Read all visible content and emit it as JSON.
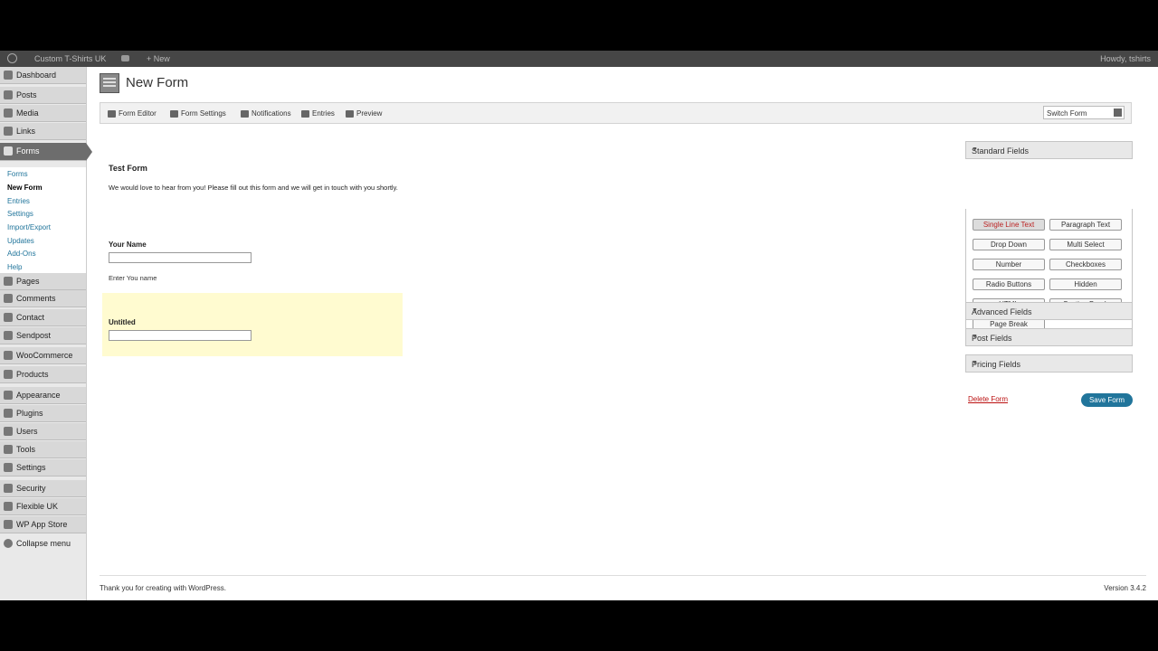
{
  "adminbar": {
    "site": "Custom T-Shirts UK",
    "new": "New",
    "howdy": "Howdy, tshirts"
  },
  "sidebar": {
    "top_items": [
      "Dashboard",
      "Posts",
      "Media",
      "Links"
    ],
    "forms_label": "Forms",
    "submenu": [
      "Forms",
      "New Form",
      "Entries",
      "Settings",
      "Import/Export",
      "Updates",
      "Add-Ons",
      "Help"
    ],
    "bottom_items": [
      "Pages",
      "Comments",
      "Contact",
      "Sendpost",
      "WooCommerce",
      "Products",
      "Appearance",
      "Plugins",
      "Users",
      "Tools",
      "Settings",
      "Security",
      "Flexible UK",
      "WP App Store",
      "Collapse menu"
    ]
  },
  "header": {
    "title": "New Form"
  },
  "toolbar": {
    "items": [
      "Form Editor",
      "Form Settings",
      "Notifications",
      "Entries",
      "Preview"
    ],
    "switch_form": "Switch Form"
  },
  "form": {
    "title": "Test Form",
    "description": "We would love to hear from you! Please fill out this form and we will get in touch with you shortly.",
    "field1_label": "Your Name",
    "field1_desc": "Enter You name",
    "field2_label": "Untitled"
  },
  "panel": {
    "standard_title": "Standard Fields",
    "standard_buttons": [
      "Single Line Text",
      "Paragraph Text",
      "Drop Down",
      "Multi Select",
      "Number",
      "Checkboxes",
      "Radio Buttons",
      "Hidden",
      "HTML",
      "Section Break",
      "Page Break"
    ],
    "advanced_title": "Advanced Fields",
    "post_title": "Post Fields",
    "pricing_title": "Pricing Fields",
    "delete": "Delete Form",
    "save": "Save Form"
  },
  "footer": {
    "thanks": "Thank you for creating with WordPress.",
    "version": "Version 3.4.2"
  }
}
